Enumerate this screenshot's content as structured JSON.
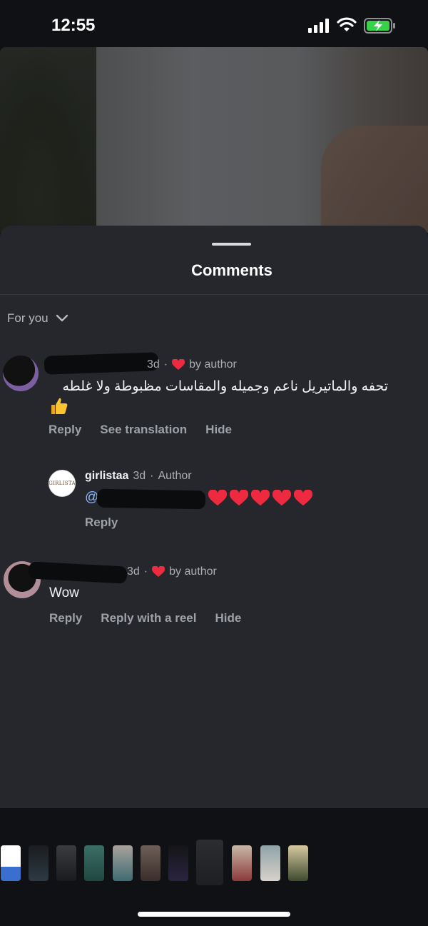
{
  "status_bar": {
    "time": "12:55"
  },
  "sheet": {
    "title": "Comments",
    "sort_label": "For you"
  },
  "comments": [
    {
      "time": "3d",
      "badge": "by author",
      "text_line1": "تحفه  والماتيريل ناعم وجميله والمقاسات مظبوطة ولا غلطه",
      "actions": [
        "Reply",
        "See translation",
        "Hide"
      ]
    },
    {
      "reply_user": "girlistaa",
      "time": "3d",
      "role": "Author",
      "mention": "@",
      "actions": [
        "Reply"
      ]
    },
    {
      "time": "3d",
      "badge": "by author",
      "text": "Wow",
      "actions": [
        "Reply",
        "Reply with a reel",
        "Hide"
      ]
    }
  ],
  "avatar_logo_text": "GIRLISTA",
  "colors": {
    "heart": "#ed2a3f",
    "sheet_bg": "#25272c",
    "app_bg": "#0f1114"
  }
}
